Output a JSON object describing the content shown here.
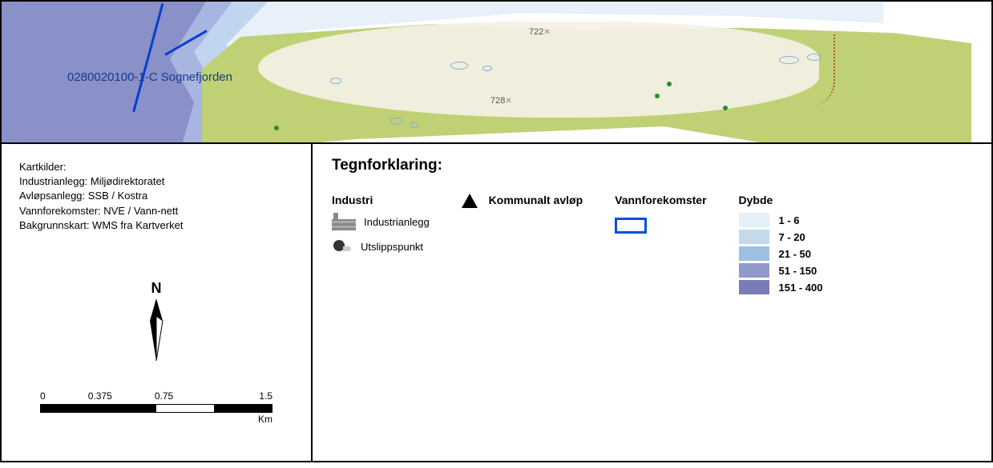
{
  "map": {
    "water_body_label": "0280020100-1-C Sognefjorden",
    "spot_heights": [
      {
        "label": "722"
      },
      {
        "label": "728"
      }
    ]
  },
  "sources": {
    "title": "Kartkilder:",
    "lines": [
      "Industrianlegg: Miljødirektoratet",
      "Avløpsanlegg: SSB / Kostra",
      "Vannforekomster: NVE / Vann-nett",
      "Bakgrunnskart: WMS fra Kartverket"
    ]
  },
  "north": {
    "label": "N"
  },
  "scale": {
    "ticks": [
      "0",
      "0.375",
      "0.75",
      "1.5"
    ],
    "unit": "Km"
  },
  "legend": {
    "title": "Tegnforklaring:",
    "industri": {
      "heading": "Industri",
      "items": [
        {
          "label": "Industrianlegg"
        },
        {
          "label": "Utslippspunkt"
        }
      ]
    },
    "kommunalt": {
      "label": "Kommunalt avløp"
    },
    "vannforekomster": {
      "heading": "Vannforekomster"
    },
    "dybde": {
      "heading": "Dybde",
      "ranges": [
        {
          "label": "1 - 6"
        },
        {
          "label": "7 - 20"
        },
        {
          "label": "21 - 50"
        },
        {
          "label": "51 - 150"
        },
        {
          "label": "151 - 400"
        }
      ]
    }
  }
}
